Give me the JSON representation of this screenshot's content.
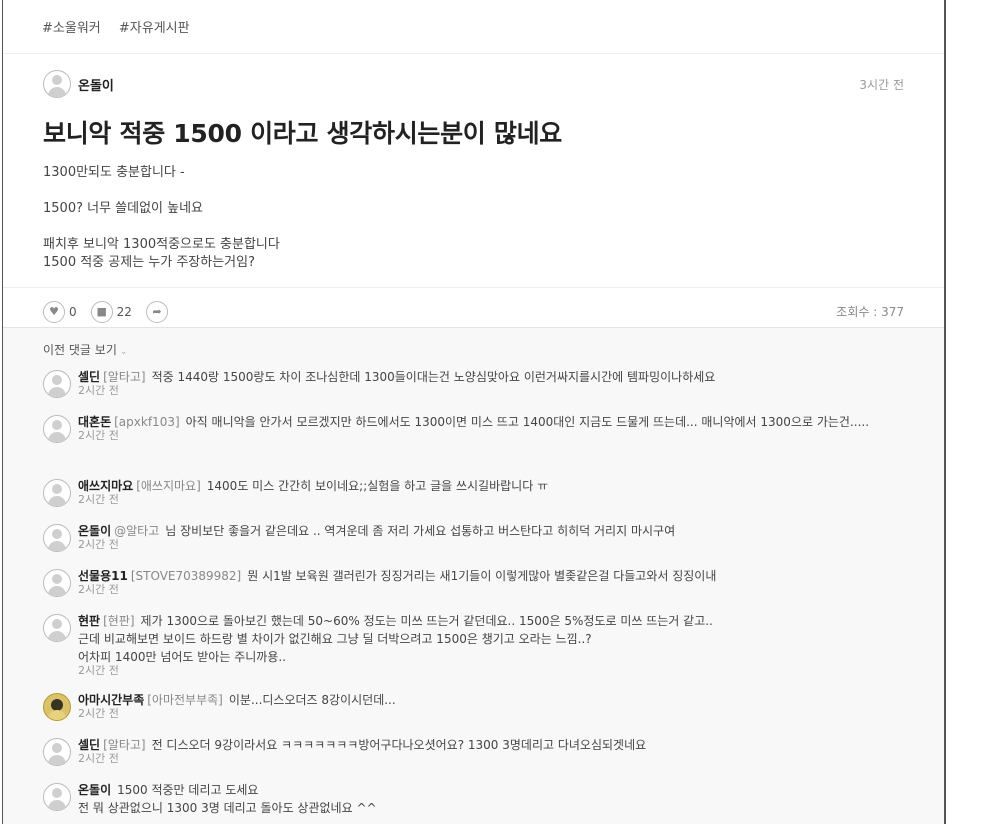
{
  "tags": [
    "#소울워커",
    "#자유게시판"
  ],
  "post": {
    "author": "온돌이",
    "time": "3시간 전",
    "title": "보니악 적중 1500 이라고 생각하시는분이 많네요",
    "paragraphs": [
      "1300만되도 충분합니다 -",
      "1500? 너무 쓸데없이 높네요",
      "패치후 보니악 1300적중으로도 충분합니다\n1500 적중 공제는 누가 주장하는거임?"
    ]
  },
  "actions": {
    "like_icon": "heart-icon",
    "like_count": "0",
    "comment_icon": "speech-bubble-icon",
    "comment_count": "22",
    "share_icon": "share-arrow-icon",
    "views": "조회수 : 377"
  },
  "comments_section": {
    "prev_label": "이전 댓글 보기",
    "prev_icon": "chevron-down-icon"
  },
  "comments": [
    {
      "name": "셀딘",
      "id": "[알타고]",
      "text": "적중 1440랑 1500랑도 차이 조나심한데 1300들이대는건 노양심맞아요  이런거싸지를시간에 템파밍이나하세요",
      "time": "2시간 전"
    },
    {
      "name": "대혼돈",
      "id": "[apxkf103]",
      "text": "아직 매니악을 안가서 모르겠지만 하드에서도 1300이면 미스 뜨고 1400대인 지금도 드물게 뜨는데... 매니악에서 1300으로 가는건.....",
      "time": "2시간 전"
    },
    {
      "name": "애쓰지마요",
      "id": "[애쓰지마요]",
      "text": "1400도 미스 간간히 보이네요;;실험을 하고 글을 쓰시길바랍니다 ㅠ",
      "time": "2시간 전"
    },
    {
      "name": "온돌이",
      "id": "@알타고",
      "text": "님 장비보단 좋을거 같은데요 .. 역겨운데 좀 저리 가세요 섭통하고 버스탄다고 히히덕 거리지 마시구여",
      "time": "2시간 전"
    },
    {
      "name": "선물용11",
      "id": "[STOVE70389982]",
      "text": "뭔 시1발 보육원 갤러린가 징징거리는 새1기들이 이렇게많아 별좆같은걸 다들고와서 징징이내",
      "time": "2시간 전"
    },
    {
      "name": "현판",
      "id": "[현판]",
      "text": "제가 1300으로 돌아보긴 했는데 50~60% 정도는 미쓰 뜨는거 같던데요.. 1500은 5%정도로 미쓰 뜨는거 같고..\n근데 비교해보면 보이드 하드랑 별 차이가 없긴해요 그냥 딜 더박으려고 1500은 챙기고 오라는 느낌..?\n어차피 1400만 넘어도 받아는 주니까용..",
      "time": "2시간 전"
    },
    {
      "name": "아마시간부족",
      "id": "[아마전부부족]",
      "text": "이분...디스오더즈 8강이시던데...",
      "time": "2시간 전"
    },
    {
      "name": "셀딘",
      "id": "[알타고]",
      "text": "전 디스오더 9강이라서요 ㅋㅋㅋㅋㅋㅋㅋ방어구다나오셧어요?  1300 3명데리고 다녀오심되겟네요",
      "time": "2시간 전"
    },
    {
      "name": "온돌이",
      "id": "",
      "text": "1500 적중만 데리고 도세요\n전 뭐 상관없으니 1300 3명 데리고 돌아도 상관없네요 ^^",
      "time": ""
    }
  ]
}
